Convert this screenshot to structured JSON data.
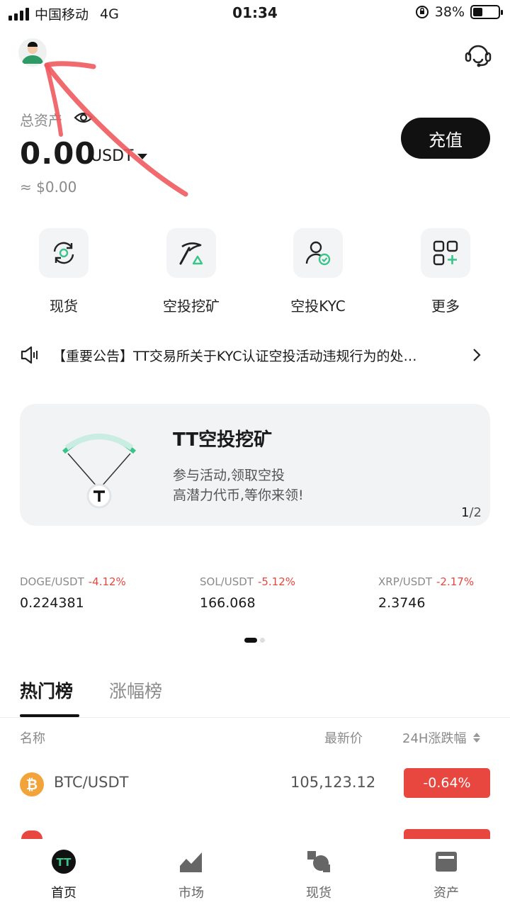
{
  "status_bar": {
    "carrier": "中国移动",
    "network": "4G",
    "time": "01:34",
    "battery": "38%",
    "battery_level": 0.38
  },
  "header": {
    "avatar_icon": "user-avatar-icon",
    "service_icon": "headset-icon"
  },
  "assets": {
    "label": "总资产",
    "value": "0.00",
    "unit": "USDT",
    "approx": "≈ $0.00",
    "deposit_label": "充值"
  },
  "quick_menu": [
    {
      "label": "现货",
      "icon": "spot-exchange-icon"
    },
    {
      "label": "空投挖矿",
      "icon": "pickaxe-icon"
    },
    {
      "label": "空投KYC",
      "icon": "kyc-user-icon"
    },
    {
      "label": "更多",
      "icon": "grid-more-icon"
    }
  ],
  "announcement": {
    "text": "【重要公告】TT交易所关于KYC认证空投活动违规行为的处…"
  },
  "banner": {
    "title": "TT空投挖矿",
    "line1": "参与活动,领取空投",
    "line2": "高潜力代币,等你来领!",
    "page_current": "1",
    "page_total": "/2",
    "accent_color": "#3bc48a"
  },
  "tickers": [
    {
      "pair": "DOGE/USDT",
      "change": "-4.12%",
      "price": "0.224381"
    },
    {
      "pair": "SOL/USDT",
      "change": "-5.12%",
      "price": "166.068"
    },
    {
      "pair": "XRP/USDT",
      "change": "-2.17%",
      "price": "2.3746"
    }
  ],
  "ranking": {
    "tabs": [
      "热门榜",
      "涨幅榜"
    ],
    "col_name": "名称",
    "col_price": "最新价",
    "col_change": "24H涨跌幅",
    "rows": [
      {
        "pair": "BTC/USDT",
        "price": "105,123.12",
        "change": "-0.64%",
        "icon_color": "#f2a33a"
      }
    ]
  },
  "bottom_nav": [
    {
      "label": "首页",
      "icon": "tt-logo-icon"
    },
    {
      "label": "市场",
      "icon": "market-chart-icon"
    },
    {
      "label": "现货",
      "icon": "spot-icon"
    },
    {
      "label": "资产",
      "icon": "wallet-icon"
    }
  ],
  "colors": {
    "down": "#e8473f",
    "primary": "#111111",
    "accent": "#3bc48a"
  }
}
